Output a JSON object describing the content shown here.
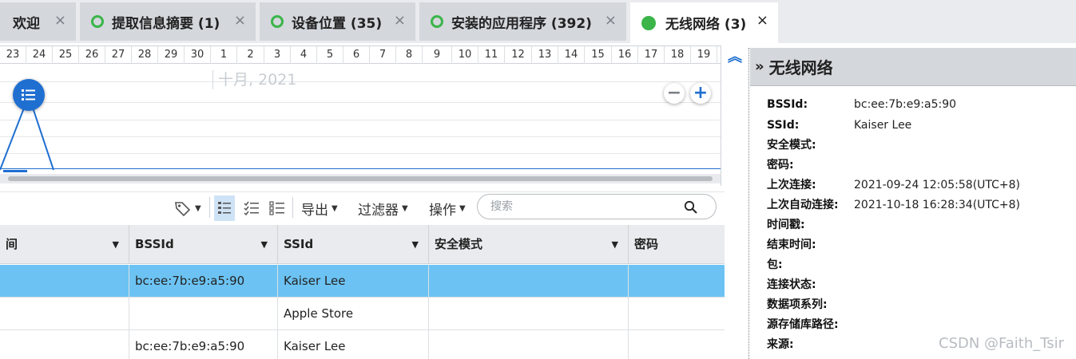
{
  "tabs": [
    {
      "label": "欢迎",
      "status": "none"
    },
    {
      "label": "提取信息摘要 (1)",
      "status": "ring"
    },
    {
      "label": "设备位置 (35)",
      "status": "ring"
    },
    {
      "label": "安装的应用程序 (392)",
      "status": "ring"
    },
    {
      "label": "无线网络 (3)",
      "status": "filled",
      "active": true
    }
  ],
  "tab_close": "×",
  "status_color": "#3bb54a",
  "timeline": {
    "days": [
      "23",
      "24",
      "25",
      "26",
      "27",
      "28",
      "29",
      "30",
      "1",
      "2",
      "3",
      "4",
      "5",
      "6",
      "7",
      "8",
      "9",
      "10",
      "11",
      "12",
      "13",
      "14",
      "15",
      "16",
      "17",
      "18",
      "19"
    ],
    "month_label": "十月, 2021",
    "event_icon": "list-icon",
    "zoom_out": "−",
    "zoom_in": "+"
  },
  "toolbar": {
    "tag_icon": "tag-icon",
    "view_icons": [
      "list-detail-icon",
      "checklist-icon",
      "list-icon"
    ],
    "export_label": "导出",
    "filter_label": "过滤器",
    "actions_label": "操作",
    "search_placeholder": "搜索"
  },
  "table": {
    "columns": [
      "间",
      "BSSId",
      "SSId",
      "安全模式",
      "密码"
    ],
    "rows": [
      {
        "time": "",
        "bssid": "bc:ee:7b:e9:a5:90",
        "ssid": "Kaiser Lee",
        "security": "",
        "password": "",
        "selected": true
      },
      {
        "time": "",
        "bssid": "",
        "ssid": "Apple Store",
        "security": "",
        "password": "",
        "selected": false
      },
      {
        "time": "",
        "bssid": "bc:ee:7b:e9:a5:90",
        "ssid": "Kaiser Lee",
        "security": "",
        "password": "",
        "selected": false
      }
    ],
    "selected_color": "#6cc3f3"
  },
  "panel": {
    "title": "无线网络",
    "properties": [
      {
        "key": "BSSId:",
        "value": "bc:ee:7b:e9:a5:90"
      },
      {
        "key": "SSId:",
        "value": "Kaiser Lee"
      },
      {
        "key": "安全模式:",
        "value": ""
      },
      {
        "key": "密码:",
        "value": ""
      },
      {
        "key": "上次连接:",
        "value": "2021-09-24 12:05:58(UTC+8)"
      },
      {
        "key": "上次自动连接:",
        "value": "2021-10-18 16:28:34(UTC+8)"
      },
      {
        "key": "时间戳:",
        "value": ""
      },
      {
        "key": "结束时间:",
        "value": ""
      },
      {
        "key": "包:",
        "value": ""
      },
      {
        "key": "连接状态:",
        "value": ""
      },
      {
        "key": "数据项系列:",
        "value": ""
      },
      {
        "key": "源存储库路径:",
        "value": ""
      },
      {
        "key": "来源:",
        "value": ""
      }
    ]
  },
  "watermark": "CSDN @Faith_Tsir",
  "accent_color": "#1f6fd1"
}
